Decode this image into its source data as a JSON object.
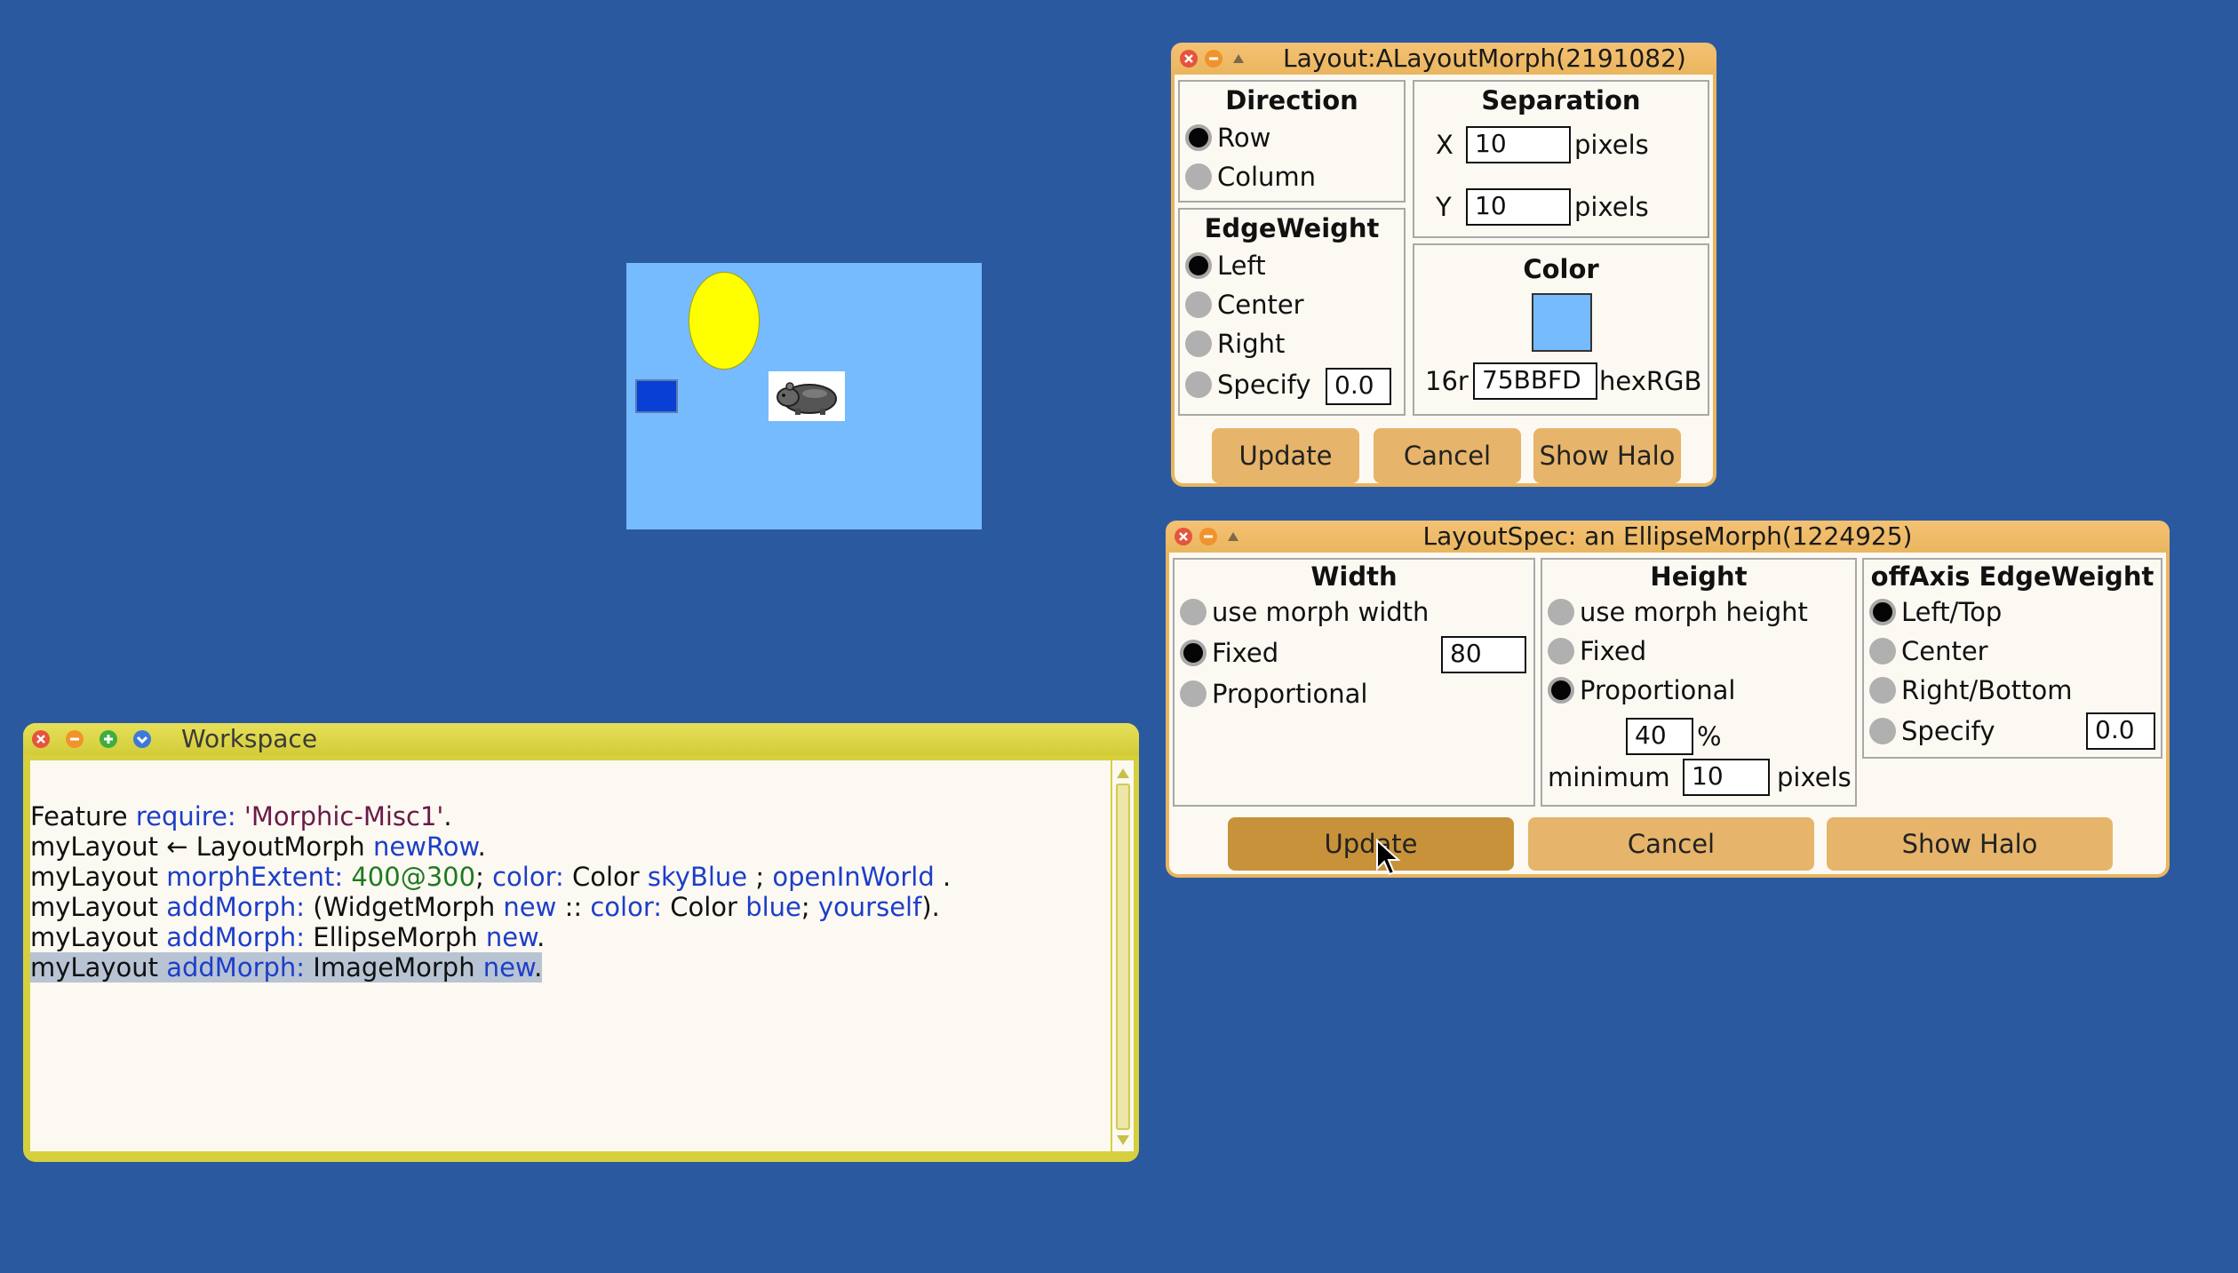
{
  "layout_window": {
    "title": "Layout:ALayoutMorph(2191082)",
    "direction": {
      "header": "Direction",
      "options": [
        "Row",
        "Column"
      ],
      "selected": "Row"
    },
    "separation": {
      "header": "Separation",
      "x_label": "X",
      "x_value": "10",
      "y_label": "Y",
      "y_value": "10",
      "unit": "pixels"
    },
    "edge_weight": {
      "header": "EdgeWeight",
      "options": [
        "Left",
        "Center",
        "Right",
        "Specify"
      ],
      "selected": "Left",
      "specify_value": "0.0"
    },
    "color": {
      "header": "Color",
      "swatch": "#75BBFD",
      "prefix": "16r",
      "value": "75BBFD",
      "suffix": "hexRGB"
    },
    "buttons": {
      "update": "Update",
      "cancel": "Cancel",
      "show_halo": "Show Halo"
    }
  },
  "layoutspec_window": {
    "title": "LayoutSpec: an EllipseMorph(1224925)",
    "width": {
      "header": "Width",
      "options": [
        "use morph width",
        "Fixed",
        "Proportional"
      ],
      "selected": "Fixed",
      "fixed_value": "80"
    },
    "height": {
      "header": "Height",
      "options": [
        "use morph height",
        "Fixed",
        "Proportional"
      ],
      "selected": "Proportional",
      "percent_value": "40",
      "percent_sign": "%",
      "minimum_label": "minimum",
      "minimum_value": "10",
      "minimum_unit": "pixels"
    },
    "off_axis": {
      "header": "offAxis EdgeWeight",
      "options": [
        "Left/Top",
        "Center",
        "Right/Bottom",
        "Specify"
      ],
      "selected": "Left/Top",
      "specify_value": "0.0"
    },
    "buttons": {
      "update": "Update",
      "cancel": "Cancel",
      "show_halo": "Show Halo"
    }
  },
  "workspace": {
    "title": "Workspace",
    "lines": [
      {
        "parts": [
          {
            "t": "Feature ",
            "c": "p"
          },
          {
            "t": "require:",
            "c": "k"
          },
          {
            "t": " ",
            "c": "p"
          },
          {
            "t": "'Morphic-Misc1'",
            "c": "s"
          },
          {
            "t": ".",
            "c": "p"
          }
        ]
      },
      {
        "parts": [
          {
            "t": "myLayout ← LayoutMorph ",
            "c": "p"
          },
          {
            "t": "newRow",
            "c": "k"
          },
          {
            "t": ".",
            "c": "p"
          }
        ]
      },
      {
        "parts": [
          {
            "t": "myLayout ",
            "c": "p"
          },
          {
            "t": "morphExtent:",
            "c": "k"
          },
          {
            "t": " 400@300",
            "c": "n"
          },
          {
            "t": "; ",
            "c": "p"
          },
          {
            "t": "color:",
            "c": "k"
          },
          {
            "t": " Color ",
            "c": "p"
          },
          {
            "t": "skyBlue",
            "c": "k"
          },
          {
            "t": " ; ",
            "c": "p"
          },
          {
            "t": "openInWorld",
            "c": "k"
          },
          {
            "t": " .",
            "c": "p"
          }
        ]
      },
      {
        "parts": [
          {
            "t": "myLayout ",
            "c": "p"
          },
          {
            "t": "addMorph:",
            "c": "k"
          },
          {
            "t": " (WidgetMorph ",
            "c": "p"
          },
          {
            "t": "new",
            "c": "k"
          },
          {
            "t": " :: ",
            "c": "p"
          },
          {
            "t": "color:",
            "c": "k"
          },
          {
            "t": " Color ",
            "c": "p"
          },
          {
            "t": "blue",
            "c": "k"
          },
          {
            "t": "; ",
            "c": "p"
          },
          {
            "t": "yourself",
            "c": "k"
          },
          {
            "t": ").",
            "c": "p"
          }
        ]
      },
      {
        "parts": [
          {
            "t": "myLayout ",
            "c": "p"
          },
          {
            "t": "addMorph:",
            "c": "k"
          },
          {
            "t": " EllipseMorph ",
            "c": "p"
          },
          {
            "t": "new",
            "c": "k"
          },
          {
            "t": ".",
            "c": "p"
          }
        ]
      },
      {
        "parts": [
          {
            "t": "myLayout ",
            "c": "p"
          },
          {
            "t": "addMorph:",
            "c": "k"
          },
          {
            "t": " ImageMorph ",
            "c": "p"
          },
          {
            "t": "new",
            "c": "k"
          },
          {
            "t": ".",
            "c": "p"
          }
        ],
        "selected": true
      }
    ]
  },
  "layout_morph": {
    "background": "#75BBFD",
    "children": [
      "blue-rectangle",
      "yellow-ellipse",
      "image-morph"
    ],
    "colors": {
      "rect": "#0a3fd6",
      "ellipse": "#ffff00"
    }
  }
}
